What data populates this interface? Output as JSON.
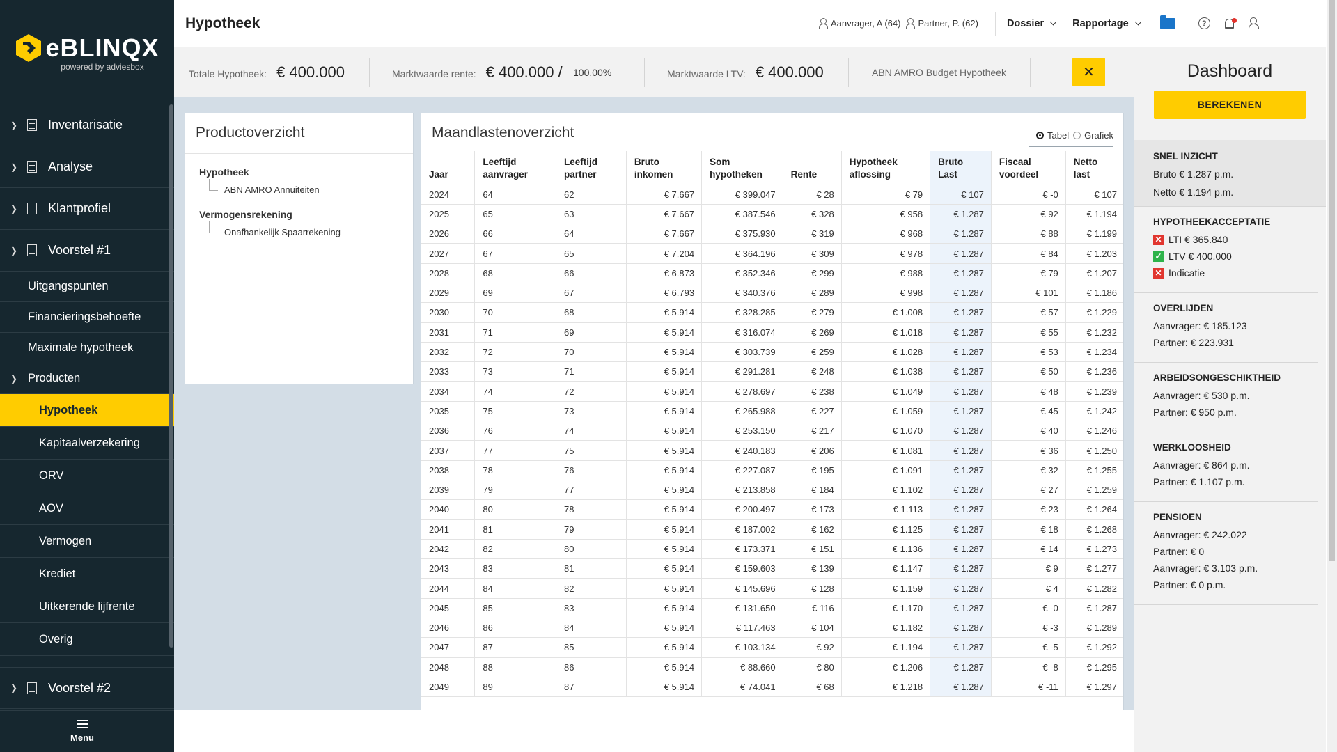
{
  "brand": {
    "logo_text": "eBLINQX",
    "tagline": "powered by adviesbox",
    "accent": "#ffcc00",
    "sidebar_bg": "#16272f"
  },
  "sidebar": {
    "sections": [
      {
        "label": "Inventarisatie"
      },
      {
        "label": "Analyse"
      },
      {
        "label": "Klantprofiel"
      },
      {
        "label": "Voorstel #1"
      }
    ],
    "sub_items": [
      "Uitgangspunten",
      "Financieringsbehoefte",
      "Maximale hypotheek"
    ],
    "producten_label": "Producten",
    "products": [
      "Hypotheek",
      "Kapitaalverzekering",
      "ORV",
      "AOV",
      "Vermogen",
      "Krediet",
      "Uitkerende lijfrente",
      "Overig"
    ],
    "active_product": "Hypotheek",
    "voorstel2_label": "Voorstel #2",
    "menu_label": "Menu"
  },
  "topbar": {
    "title": "Hypotheek",
    "applicant": "Aanvrager, A (64)",
    "partner": "Partner, P. (62)",
    "dossier_label": "Dossier",
    "rapportage_label": "Rapportage",
    "help_glyph": "?"
  },
  "summary": {
    "totale_label": "Totale Hypotheek:",
    "totale_value": "€ 400.000",
    "marktwaarde_label": "Marktwaarde rente:",
    "marktwaarde_value": "€ 400.000",
    "slash": "/",
    "percentage": "100,00%",
    "ltv_label": "Marktwaarde LTV:",
    "ltv_value": "€ 400.000",
    "product_name": "ABN AMRO Budget Hypotheek",
    "close_glyph": "✕"
  },
  "productoverzicht": {
    "title": "Productoverzicht",
    "groups": [
      {
        "head": "Hypotheek",
        "item": "ABN AMRO Annuiteiten"
      },
      {
        "head": "Vermogensrekening",
        "item": "Onafhankelijk Spaarrekening"
      }
    ]
  },
  "maandlasten": {
    "title": "Maandlastenoverzicht",
    "view_tabel": "Tabel",
    "view_grafiek": "Grafiek",
    "selected_view": "Tabel",
    "headers": [
      [
        "Jaar"
      ],
      [
        "Leeftijd",
        "aanvrager"
      ],
      [
        "Leeftijd",
        "partner"
      ],
      [
        "Bruto",
        "inkomen"
      ],
      [
        "Som",
        "hypotheken"
      ],
      [
        "Rente"
      ],
      [
        "Hypotheek",
        "aflossing"
      ],
      [
        "Bruto",
        "Last"
      ],
      [
        "Fiscaal",
        "voordeel"
      ],
      [
        "Netto",
        "last"
      ]
    ],
    "rows": [
      [
        "2024",
        "64",
        "62",
        "€ 7.667",
        "€ 399.047",
        "€ 28",
        "€ 79",
        "€ 107",
        "€ -0",
        "€ 107"
      ],
      [
        "2025",
        "65",
        "63",
        "€ 7.667",
        "€ 387.546",
        "€ 328",
        "€ 958",
        "€ 1.287",
        "€ 92",
        "€ 1.194"
      ],
      [
        "2026",
        "66",
        "64",
        "€ 7.667",
        "€ 375.930",
        "€ 319",
        "€ 968",
        "€ 1.287",
        "€ 88",
        "€ 1.199"
      ],
      [
        "2027",
        "67",
        "65",
        "€ 7.204",
        "€ 364.196",
        "€ 309",
        "€ 978",
        "€ 1.287",
        "€ 84",
        "€ 1.203"
      ],
      [
        "2028",
        "68",
        "66",
        "€ 6.873",
        "€ 352.346",
        "€ 299",
        "€ 988",
        "€ 1.287",
        "€ 79",
        "€ 1.207"
      ],
      [
        "2029",
        "69",
        "67",
        "€ 6.793",
        "€ 340.376",
        "€ 289",
        "€ 998",
        "€ 1.287",
        "€ 101",
        "€ 1.186"
      ],
      [
        "2030",
        "70",
        "68",
        "€ 5.914",
        "€ 328.285",
        "€ 279",
        "€ 1.008",
        "€ 1.287",
        "€ 57",
        "€ 1.229"
      ],
      [
        "2031",
        "71",
        "69",
        "€ 5.914",
        "€ 316.074",
        "€ 269",
        "€ 1.018",
        "€ 1.287",
        "€ 55",
        "€ 1.232"
      ],
      [
        "2032",
        "72",
        "70",
        "€ 5.914",
        "€ 303.739",
        "€ 259",
        "€ 1.028",
        "€ 1.287",
        "€ 53",
        "€ 1.234"
      ],
      [
        "2033",
        "73",
        "71",
        "€ 5.914",
        "€ 291.281",
        "€ 248",
        "€ 1.038",
        "€ 1.287",
        "€ 50",
        "€ 1.236"
      ],
      [
        "2034",
        "74",
        "72",
        "€ 5.914",
        "€ 278.697",
        "€ 238",
        "€ 1.049",
        "€ 1.287",
        "€ 48",
        "€ 1.239"
      ],
      [
        "2035",
        "75",
        "73",
        "€ 5.914",
        "€ 265.988",
        "€ 227",
        "€ 1.059",
        "€ 1.287",
        "€ 45",
        "€ 1.242"
      ],
      [
        "2036",
        "76",
        "74",
        "€ 5.914",
        "€ 253.150",
        "€ 217",
        "€ 1.070",
        "€ 1.287",
        "€ 40",
        "€ 1.246"
      ],
      [
        "2037",
        "77",
        "75",
        "€ 5.914",
        "€ 240.183",
        "€ 206",
        "€ 1.081",
        "€ 1.287",
        "€ 36",
        "€ 1.250"
      ],
      [
        "2038",
        "78",
        "76",
        "€ 5.914",
        "€ 227.087",
        "€ 195",
        "€ 1.091",
        "€ 1.287",
        "€ 32",
        "€ 1.255"
      ],
      [
        "2039",
        "79",
        "77",
        "€ 5.914",
        "€ 213.858",
        "€ 184",
        "€ 1.102",
        "€ 1.287",
        "€ 27",
        "€ 1.259"
      ],
      [
        "2040",
        "80",
        "78",
        "€ 5.914",
        "€ 200.497",
        "€ 173",
        "€ 1.113",
        "€ 1.287",
        "€ 23",
        "€ 1.264"
      ],
      [
        "2041",
        "81",
        "79",
        "€ 5.914",
        "€ 187.002",
        "€ 162",
        "€ 1.125",
        "€ 1.287",
        "€ 18",
        "€ 1.268"
      ],
      [
        "2042",
        "82",
        "80",
        "€ 5.914",
        "€ 173.371",
        "€ 151",
        "€ 1.136",
        "€ 1.287",
        "€ 14",
        "€ 1.273"
      ],
      [
        "2043",
        "83",
        "81",
        "€ 5.914",
        "€ 159.603",
        "€ 139",
        "€ 1.147",
        "€ 1.287",
        "€ 9",
        "€ 1.277"
      ],
      [
        "2044",
        "84",
        "82",
        "€ 5.914",
        "€ 145.696",
        "€ 128",
        "€ 1.159",
        "€ 1.287",
        "€ 4",
        "€ 1.282"
      ],
      [
        "2045",
        "85",
        "83",
        "€ 5.914",
        "€ 131.650",
        "€ 116",
        "€ 1.170",
        "€ 1.287",
        "€ -0",
        "€ 1.287"
      ],
      [
        "2046",
        "86",
        "84",
        "€ 5.914",
        "€ 117.463",
        "€ 104",
        "€ 1.182",
        "€ 1.287",
        "€ -3",
        "€ 1.289"
      ],
      [
        "2047",
        "87",
        "85",
        "€ 5.914",
        "€ 103.134",
        "€ 92",
        "€ 1.194",
        "€ 1.287",
        "€ -5",
        "€ 1.292"
      ],
      [
        "2048",
        "88",
        "86",
        "€ 5.914",
        "€ 88.660",
        "€ 80",
        "€ 1.206",
        "€ 1.287",
        "€ -8",
        "€ 1.295"
      ],
      [
        "2049",
        "89",
        "87",
        "€ 5.914",
        "€ 74.041",
        "€ 68",
        "€ 1.218",
        "€ 1.287",
        "€ -11",
        "€ 1.297"
      ]
    ]
  },
  "dashboard": {
    "title": "Dashboard",
    "calc_label": "BEREKENEN",
    "snel_inzicht": {
      "head": "SNEL INZICHT",
      "bruto": "Bruto € 1.287 p.m.",
      "netto": "Netto € 1.194 p.m."
    },
    "acceptatie": {
      "head": "HYPOTHEEKACCEPTATIE",
      "items": [
        {
          "status": "fail",
          "text": "LTI € 365.840"
        },
        {
          "status": "ok",
          "text": "LTV € 400.000"
        },
        {
          "status": "fail",
          "text": "Indicatie"
        }
      ]
    },
    "overlijden": {
      "head": "OVERLIJDEN",
      "lines": [
        "Aanvrager: € 185.123",
        "Partner: € 223.931"
      ]
    },
    "arbeid": {
      "head": "ARBEIDSONGESCHIKTHEID",
      "lines": [
        "Aanvrager: € 530 p.m.",
        "Partner: € 950 p.m."
      ]
    },
    "werkloos": {
      "head": "WERKLOOSHEID",
      "lines": [
        "Aanvrager: € 864 p.m.",
        "Partner: € 1.107 p.m."
      ]
    },
    "pensioen": {
      "head": "PENSIOEN",
      "lines": [
        "Aanvrager: € 242.022",
        "Partner: € 0",
        "Aanvrager: € 3.103 p.m.",
        "Partner: € 0 p.m."
      ]
    }
  }
}
